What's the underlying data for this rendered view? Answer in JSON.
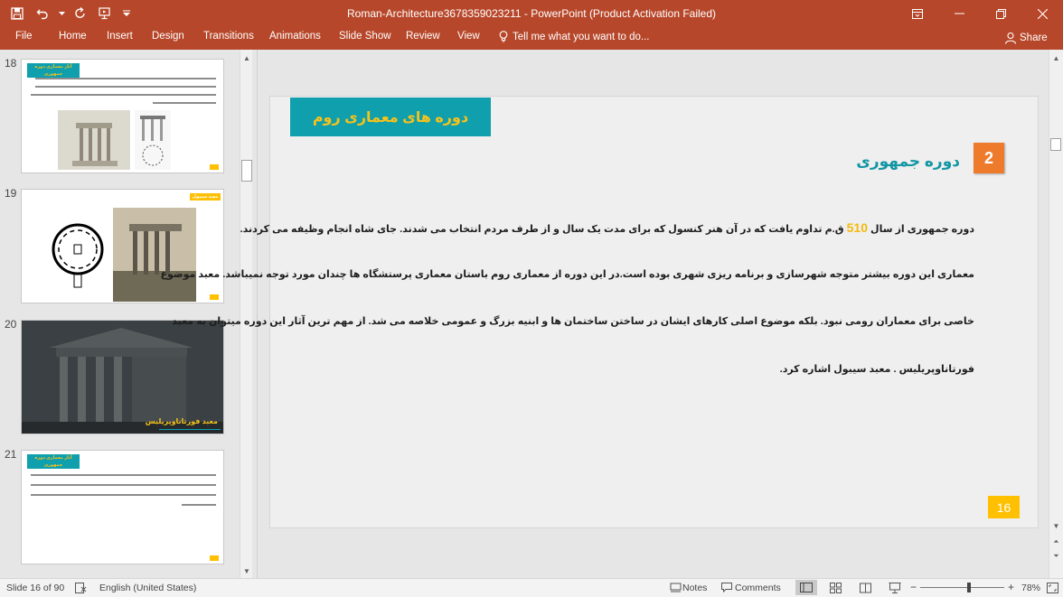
{
  "window": {
    "title": "Roman-Architecture3678359023211 - PowerPoint (Product Activation Failed)"
  },
  "ribbon": {
    "file": "File",
    "tabs": [
      "Home",
      "Insert",
      "Design",
      "Transitions",
      "Animations",
      "Slide Show",
      "Review",
      "View"
    ],
    "tell_me": "Tell me what you want to do...",
    "share": "Share"
  },
  "thumbnails": [
    {
      "number": "18",
      "tag": "آثار معماری دوره جمهوری"
    },
    {
      "number": "19",
      "tag": "معبد سیبول"
    },
    {
      "number": "20",
      "caption": "معبد فورتاناوپریلیس"
    },
    {
      "number": "21",
      "tag": "آثار معماری دوره جمهوری"
    }
  ],
  "slide": {
    "banner": "دوره های معماری روم",
    "section_number": "2",
    "heading": "دوره جمهوری",
    "para1_a": "دوره جمهوری از سال ",
    "para1_year": "510",
    "para1_b": " ق.م تداوم یافت که در آن هنر کنسول که برای مدت یک سال و از طرف مردم انتخاب می شدند. جای شاه انجام وظیفه می کردند.",
    "para2": "معماری این دوره بیشتر متوجه شهرسازی و برنامه ریزی شهری بوده است.در این دوره از معماری روم باستان معماری پرستشگاه ها چندان مورد توجه نمیباشد. معبد موضوع",
    "para3": "خاصی برای معماران رومی نبود. بلکه موضوع اصلی کارهای ایشان در ساختن ساختمان ها و ابنیه بزرگ و عمومی خلاصه می شد. از مهم ترین آثار این دوره میتوان به معبد",
    "para4": "فورتاناوپریلیس . معبد سیبول اشاره کرد.",
    "page_number": "16"
  },
  "status": {
    "slide_info": "Slide 16 of 90",
    "language": "English (United States)",
    "notes": "Notes",
    "comments": "Comments",
    "zoom": "78%",
    "zoom_fraction": 0.58
  },
  "colors": {
    "ribbon": "#b7472a",
    "teal": "#0f9fad",
    "accent_yellow": "#f6c21c",
    "orange": "#ee7a2c"
  }
}
